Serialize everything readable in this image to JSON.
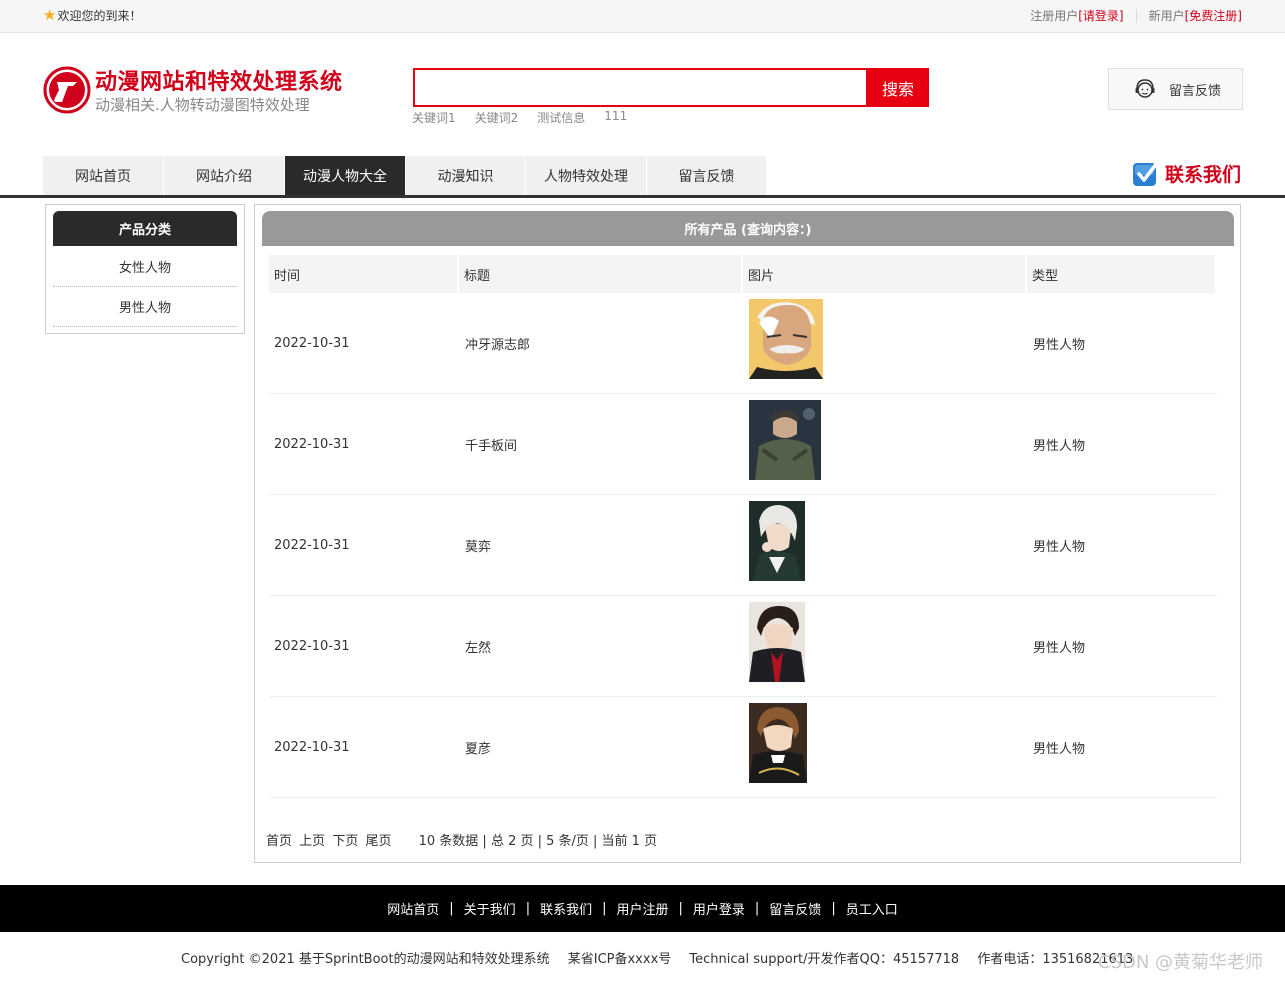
{
  "topbar": {
    "welcome": "欢迎您的到来！",
    "registered_label": "注册用户",
    "login_link": "[请登录]",
    "new_user_label": "新用户",
    "register_link": "[免费注册]"
  },
  "header": {
    "title": "动漫网站和特效处理系统",
    "subtitle": "动漫相关.人物转动漫图特效处理",
    "search_value": "",
    "search_button": "搜索",
    "hot_keywords": [
      "关键词1",
      "关键词2",
      "测试信息",
      "111"
    ],
    "feedback_button": "留言反馈"
  },
  "nav": {
    "items": [
      {
        "label": "网站首页",
        "active": false
      },
      {
        "label": "网站介绍",
        "active": false
      },
      {
        "label": "动漫人物大全",
        "active": true
      },
      {
        "label": "动漫知识",
        "active": false
      },
      {
        "label": "人物特效处理",
        "active": false
      },
      {
        "label": "留言反馈",
        "active": false
      }
    ],
    "contact": "联系我们"
  },
  "sidebar": {
    "title": "产品分类",
    "categories": [
      "女性人物",
      "男性人物"
    ]
  },
  "main": {
    "title": "所有产品 (查询内容：)",
    "columns": [
      "时间",
      "标题",
      "图片",
      "类型"
    ],
    "rows": [
      {
        "date": "2022-10-31",
        "title": "冲牙源志郎",
        "type": "男性人物",
        "image": "character-portrait"
      },
      {
        "date": "2022-10-31",
        "title": "千手板间",
        "type": "男性人物",
        "image": "character-portrait"
      },
      {
        "date": "2022-10-31",
        "title": "莫弈",
        "type": "男性人物",
        "image": "character-portrait"
      },
      {
        "date": "2022-10-31",
        "title": "左然",
        "type": "男性人物",
        "image": "character-portrait"
      },
      {
        "date": "2022-10-31",
        "title": "夏彦",
        "type": "男性人物",
        "image": "character-portrait"
      }
    ],
    "pager": {
      "first": "首页",
      "prev": "上页",
      "next": "下页",
      "last": "尾页",
      "info": "10 条数据 | 总 2 页 | 5 条/页 | 当前 1 页"
    }
  },
  "footer": {
    "links": [
      "网站首页",
      "关于我们",
      "联系我们",
      "用户注册",
      "用户登录",
      "留言反馈",
      "员工入口"
    ],
    "copyright": "Copyright ©2021 基于SprintBoot的动漫网站和特效处理系统",
    "icp": "某省ICP备xxxx号",
    "support": "Technical support/开发作者QQ：45157718",
    "phone": "作者电话：13516821613",
    "watermark": "CSDN @黄菊华老师"
  },
  "colors": {
    "accent": "#e60012",
    "nav_active": "#2a2a2a",
    "table_header": "#999999"
  }
}
